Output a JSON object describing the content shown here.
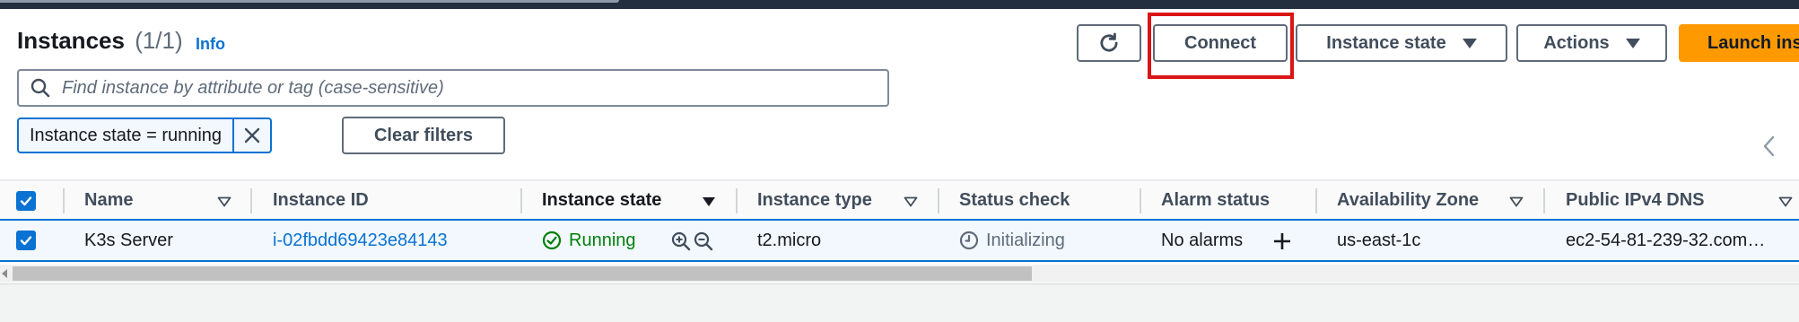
{
  "header": {
    "title": "Instances",
    "count": "(1/1)",
    "info_link": "Info"
  },
  "toolbar": {
    "refresh_icon": "refresh-icon",
    "connect_label": "Connect",
    "instance_state_label": "Instance state",
    "actions_label": "Actions",
    "launch_label": "Launch ins",
    "launch_color": "#ff9900",
    "highlight_color": "#d91515"
  },
  "search": {
    "placeholder": "Find instance by attribute or tag (case-sensitive)",
    "value": ""
  },
  "filters": {
    "token_label": "Instance state = running",
    "clear_label": "Clear filters"
  },
  "table": {
    "columns": [
      "Name",
      "Instance ID",
      "Instance state",
      "Instance type",
      "Status check",
      "Alarm status",
      "Availability Zone",
      "Public IPv4 DNS"
    ],
    "rows": [
      {
        "selected": true,
        "name": "K3s Server",
        "instance_id": "i-02fbdd69423e84143",
        "instance_state": "Running",
        "instance_type": "t2.micro",
        "status_check": "Initializing",
        "alarm_status": "No alarms",
        "availability_zone": "us-east-1c",
        "public_dns": "ec2-54-81-239-32.com…"
      }
    ]
  },
  "colors": {
    "accent": "#0972d3",
    "running": "#037f0c",
    "topbar": "#232f3e"
  }
}
